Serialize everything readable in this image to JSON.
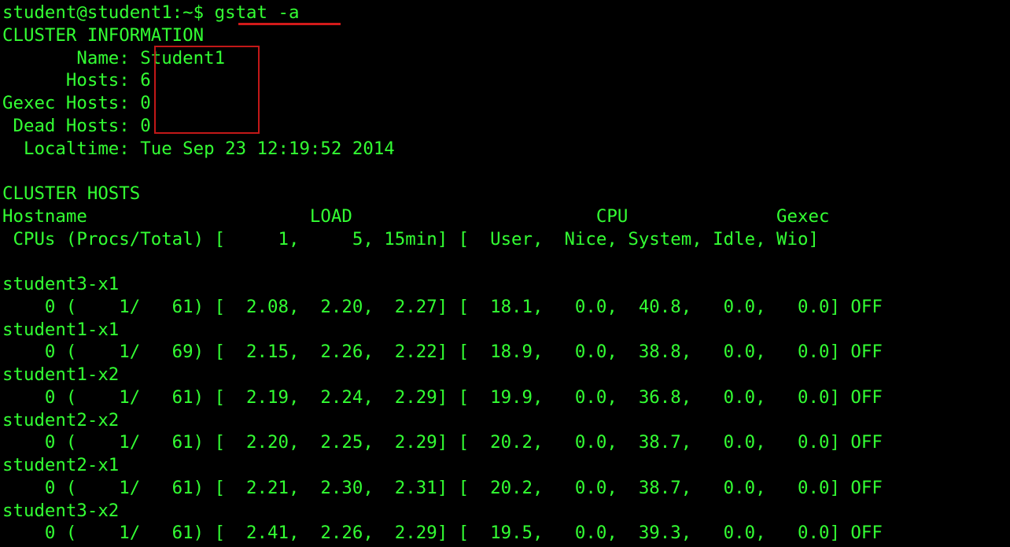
{
  "prompt": "student@student1:~$ ",
  "command": "gstat -a",
  "cluster_info": {
    "heading": "CLUSTER INFORMATION",
    "fields": [
      {
        "label": "       Name: ",
        "value": "Student1"
      },
      {
        "label": "      Hosts: ",
        "value": "6"
      },
      {
        "label": "Gexec Hosts: ",
        "value": "0"
      },
      {
        "label": " Dead Hosts: ",
        "value": "0"
      },
      {
        "label": "  Localtime: ",
        "value": "Tue Sep 23 12:19:52 2014"
      }
    ]
  },
  "cluster_hosts": {
    "heading": "CLUSTER HOSTS",
    "header_line1": "Hostname                     LOAD                       CPU              Gexec",
    "header_line2": " CPUs (Procs/Total) [     1,     5, 15min] [  User,  Nice, System, Idle, Wio]",
    "hosts": [
      {
        "name": "student3-x1",
        "stats": "    0 (    1/   61) [  2.08,  2.20,  2.27] [  18.1,   0.0,  40.8,   0.0,   0.0] OFF"
      },
      {
        "name": "student1-x1",
        "stats": "    0 (    1/   69) [  2.15,  2.26,  2.22] [  18.9,   0.0,  38.8,   0.0,   0.0] OFF"
      },
      {
        "name": "student1-x2",
        "stats": "    0 (    1/   61) [  2.19,  2.24,  2.29] [  19.9,   0.0,  36.8,   0.0,   0.0] OFF"
      },
      {
        "name": "student2-x2",
        "stats": "    0 (    1/   61) [  2.20,  2.25,  2.29] [  20.2,   0.0,  38.7,   0.0,   0.0] OFF"
      },
      {
        "name": "student2-x1",
        "stats": "    0 (    1/   61) [  2.21,  2.30,  2.31] [  20.2,   0.0,  38.7,   0.0,   0.0] OFF"
      },
      {
        "name": "student3-x2",
        "stats": "    0 (    1/   61) [  2.41,  2.26,  2.29] [  19.5,   0.0,  39.3,   0.0,   0.0] OFF"
      }
    ]
  },
  "colors": {
    "text": "#33ff33",
    "background": "#000000",
    "annotation": "#d21a1a"
  }
}
